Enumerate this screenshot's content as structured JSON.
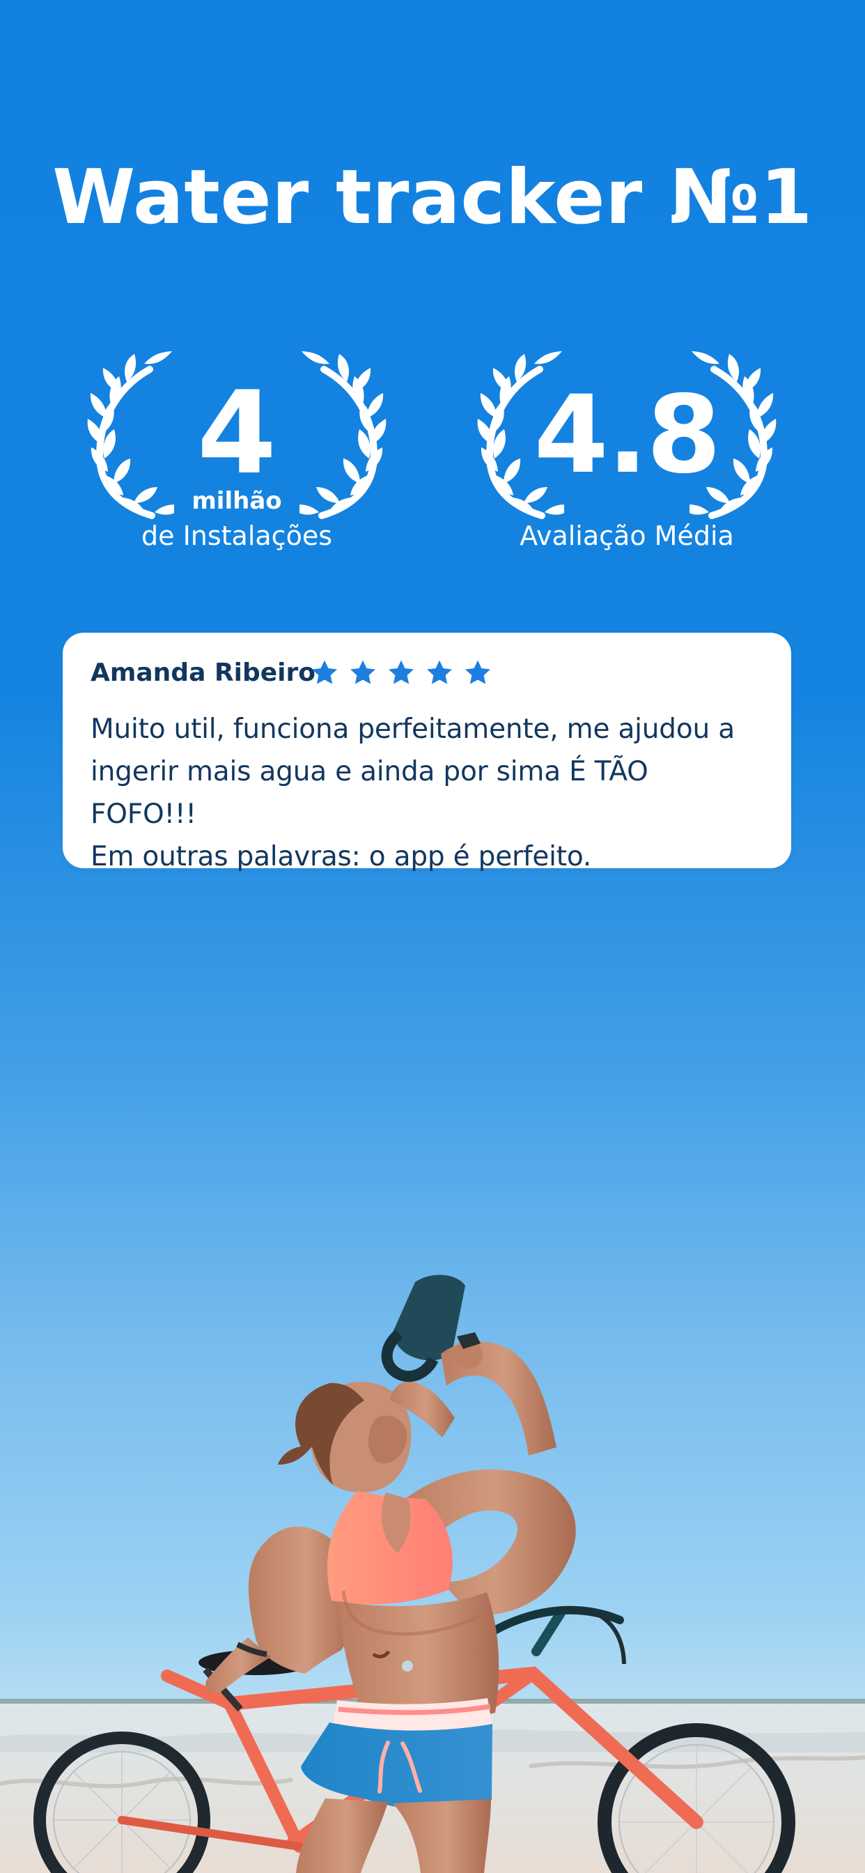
{
  "headline": "Water tracker №1",
  "stats": {
    "installs": {
      "value": "4",
      "unit": "milhão",
      "caption": "de Instalações"
    },
    "rating": {
      "value": "4.8",
      "caption": "Avaliação Média"
    }
  },
  "review": {
    "author": "Amanda Ribeiro",
    "stars": 5,
    "text_lines": [
      "Muito util, funciona perfeitamente, me ajudou a",
      "ingerir mais agua e ainda por sima É TÃO FOFO!!!",
      "Em outras palavras: o app é perfeito."
    ]
  },
  "colors": {
    "background_top": "#1280df",
    "accent_blue": "#1b7fe0",
    "review_text": "#12375f",
    "card_background": "#ffffff"
  },
  "icons": {
    "laurel": "laurel-wreath-icon",
    "star": "star-icon"
  }
}
